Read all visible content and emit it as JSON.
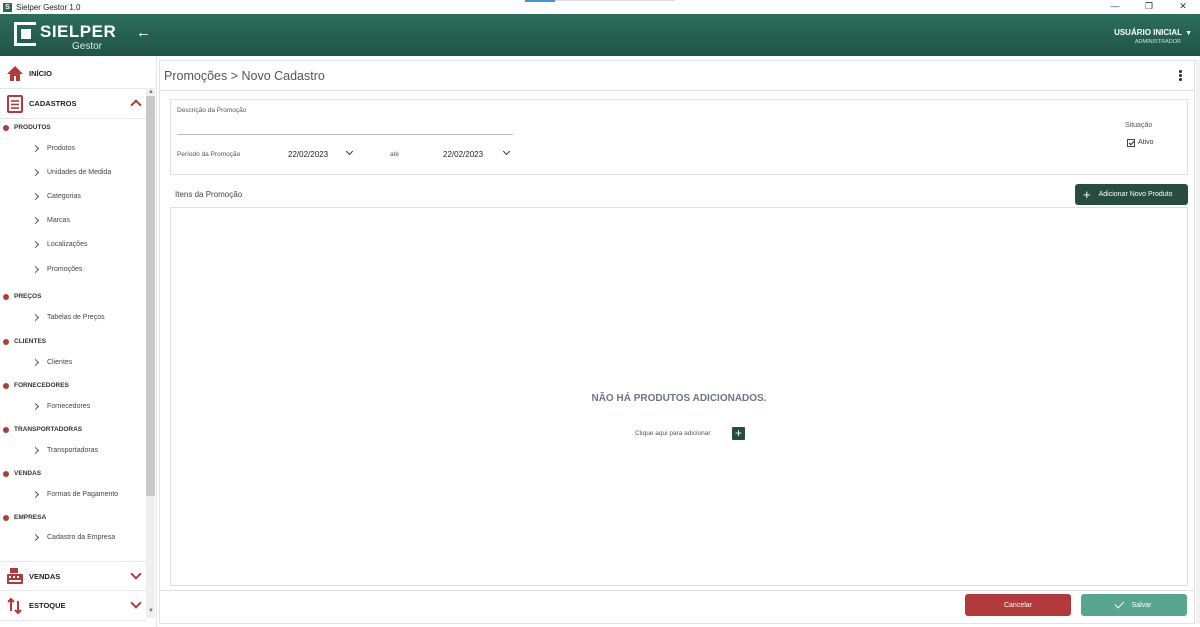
{
  "window": {
    "title": "Sielper Gestor 1.0",
    "controls": [
      "—",
      "❐",
      "✕"
    ]
  },
  "header": {
    "logo_name": "SIELPER",
    "logo_sub": "Gestor",
    "user_name": "USUÁRIO INICIAL",
    "user_role": "ADMINISTRADOR",
    "accent": "#1e5446"
  },
  "sidebar": {
    "inicio": "INÍCIO",
    "cadastros": "CADASTROS",
    "vendas": "VENDAS",
    "estoque": "ESTOQUE",
    "groups": [
      {
        "label": "PRODUTOS",
        "items": [
          "Produtos",
          "Unidades de Medida",
          "Categorias",
          "Marcas",
          "Localizações",
          "Promoções"
        ]
      },
      {
        "label": "PREÇOS",
        "items": [
          "Tabelas de Preços"
        ]
      },
      {
        "label": "CLIENTES",
        "items": [
          "Clientes"
        ]
      },
      {
        "label": "FORNECEDORES",
        "items": [
          "Fornecedores"
        ]
      },
      {
        "label": "TRANSPORTADORAS",
        "items": [
          "Transportadoras"
        ]
      },
      {
        "label": "VENDAS",
        "items": [
          "Formas de Pagamento"
        ]
      },
      {
        "label": "EMPRESA",
        "items": [
          "Cadastro da Empresa"
        ]
      }
    ]
  },
  "main": {
    "title": "Promoções > Novo Cadastro",
    "form": {
      "desc_label": "Descrição da Promoção",
      "desc_value": "",
      "period_label": "Período da Promoção",
      "date_start": "22/02/2023",
      "ate_label": "até",
      "date_end": "22/02/2023",
      "situacao_label": "Situação",
      "ativo_label": "Ativo",
      "ativo_checked": true
    },
    "items": {
      "title": "Itens da Promoção",
      "add_button": "Adicionar Novo Produto",
      "empty_title": "NÃO HÁ PRODUTOS ADICIONADOS.",
      "empty_hint": "Clique aqui para adicionar"
    },
    "footer": {
      "cancel": "Cancelar",
      "save": "Salvar"
    }
  },
  "colors": {
    "danger": "#b23a3a",
    "success": "#58a690",
    "dark_green": "#264d40"
  }
}
